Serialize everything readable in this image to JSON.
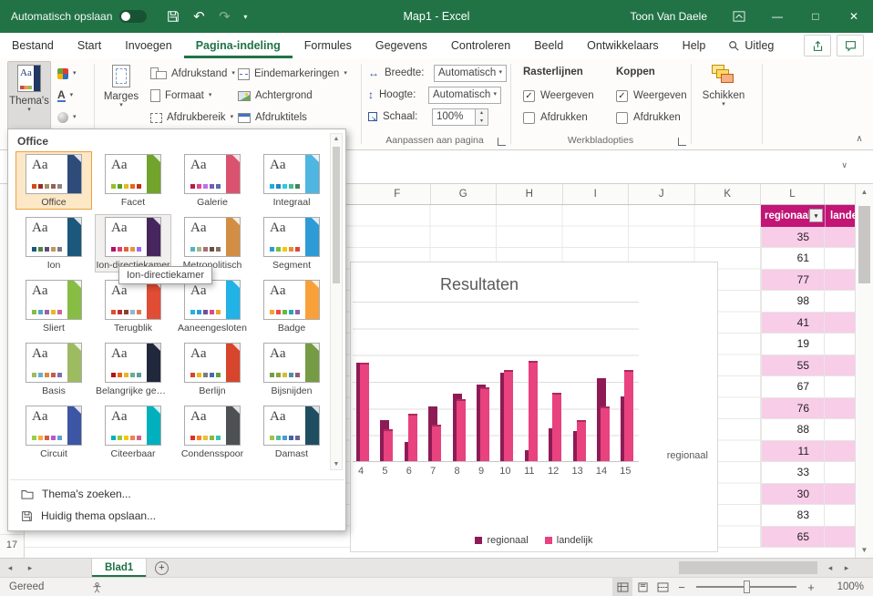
{
  "titlebar": {
    "autosave_label": "Automatisch opslaan",
    "title": "Map1 - Excel",
    "user": "Toon Van Daele"
  },
  "icons": {
    "undo": "↶",
    "redo": "↷",
    "menu_caret": "▾",
    "collapse_ribbon": "∧",
    "expand_formula": "∨",
    "minimize": "—",
    "maximize": "□",
    "close": "✕",
    "scroll_up": "▲",
    "scroll_down": "▼",
    "nav_left": "◂",
    "nav_right": "▸",
    "new_sheet": "+",
    "zoom_out": "−",
    "zoom_in": "+",
    "check": "✓",
    "filter_caret": "▾",
    "spin_up": "▴",
    "spin_down": "▾"
  },
  "tabs": [
    {
      "label": "Bestand",
      "cls": ""
    },
    {
      "label": "Start",
      "cls": ""
    },
    {
      "label": "Invoegen",
      "cls": ""
    },
    {
      "label": "Pagina-indeling",
      "cls": "active"
    },
    {
      "label": "Formules",
      "cls": ""
    },
    {
      "label": "Gegevens",
      "cls": ""
    },
    {
      "label": "Controleren",
      "cls": ""
    },
    {
      "label": "Beeld",
      "cls": ""
    },
    {
      "label": "Ontwikkelaars",
      "cls": ""
    },
    {
      "label": "Help",
      "cls": ""
    }
  ],
  "search_tab": "Uitleg",
  "ribbon": {
    "themes": {
      "label": "Thema's"
    },
    "page_setup": {
      "marges": "Marges",
      "afdrukstand": "Afdrukstand",
      "formaat": "Formaat",
      "afdrukbereik": "Afdrukbereik",
      "eindemarkeringen": "Eindemarkeringen",
      "achtergrond": "Achtergrond",
      "afdruktitels": "Afdruktitels"
    },
    "scale_to_fit": {
      "group_label": "Aanpassen aan pagina",
      "width_label": "Breedte:",
      "width_value": "Automatisch",
      "height_label": "Hoogte:",
      "height_value": "Automatisch",
      "scale_label": "Schaal:",
      "scale_value": "100%"
    },
    "sheet_options": {
      "group_label": "Werkbladopties",
      "gridlines_label": "Rasterlijnen",
      "headings_label": "Koppen",
      "view_label": "Weergeven",
      "print_label": "Afdrukken"
    },
    "arrange": {
      "label": "Schikken"
    }
  },
  "themes_menu": {
    "section_label": "Office",
    "tooltip": "Ion-directiekamer",
    "footer": [
      {
        "label": "Thema's zoeken...",
        "icon": "browse-icon"
      },
      {
        "label": "Huidig thema opslaan...",
        "icon": "save-icon"
      }
    ],
    "tiles": [
      {
        "name": "Office",
        "cls": "selected",
        "band": "#2E4B7A",
        "dots": [
          "#D34817",
          "#9B2D1F",
          "#A28E6A",
          "#956251",
          "#918485"
        ]
      },
      {
        "name": "Facet",
        "cls": "",
        "band": "#72A32D",
        "dots": [
          "#90C226",
          "#54A021",
          "#E6B91E",
          "#E76618",
          "#C42F1A"
        ]
      },
      {
        "name": "Galerie",
        "cls": "",
        "band": "#D9536E",
        "dots": [
          "#B71E42",
          "#DE478E",
          "#BC72F0",
          "#795FAF",
          "#586EA6"
        ]
      },
      {
        "name": "Integraal",
        "cls": "",
        "band": "#4FB6E2",
        "dots": [
          "#1CADE4",
          "#2683C6",
          "#27CED7",
          "#42BA97",
          "#3E8853"
        ]
      },
      {
        "name": "Ion",
        "cls": "",
        "band": "#1B587C",
        "dots": [
          "#1B587C",
          "#4E8542",
          "#604878",
          "#C19859",
          "#797B7E"
        ]
      },
      {
        "name": "Ion-directiekamer",
        "cls": "hovered",
        "band": "#46265C",
        "dots": [
          "#B31166",
          "#E33D6F",
          "#E45F3C",
          "#E9943A",
          "#9B6BF2"
        ]
      },
      {
        "name": "Metropolitisch",
        "cls": "",
        "band": "#D28E45",
        "dots": [
          "#50B4C8",
          "#A8B789",
          "#AB6D76",
          "#684E40",
          "#816F62"
        ]
      },
      {
        "name": "Segment",
        "cls": "",
        "band": "#2E9BD6",
        "dots": [
          "#2E9BD6",
          "#77BF44",
          "#F2C80F",
          "#E98C3A",
          "#D64A3B"
        ]
      },
      {
        "name": "Sliert",
        "cls": "",
        "band": "#87BC45",
        "dots": [
          "#87BC45",
          "#54A6C4",
          "#9B62A7",
          "#E6B91E",
          "#D1609C"
        ]
      },
      {
        "name": "Terugblik",
        "cls": "",
        "band": "#E04C34",
        "dots": [
          "#E04C34",
          "#BA2F2A",
          "#84442F",
          "#94B6D2",
          "#DD8047"
        ]
      },
      {
        "name": "Aaneengesloten",
        "cls": "",
        "band": "#21B2E6",
        "dots": [
          "#21B2E6",
          "#2D9DD8",
          "#6F4F9C",
          "#D94A8C",
          "#F0A22E"
        ]
      },
      {
        "name": "Badge",
        "cls": "",
        "band": "#F8A13A",
        "dots": [
          "#F8A13A",
          "#EF4A45",
          "#5FBB46",
          "#32A0B4",
          "#8C62A8"
        ]
      },
      {
        "name": "Basis",
        "cls": "",
        "band": "#9DBB61",
        "dots": [
          "#9DBB61",
          "#66B0CC",
          "#D98A3A",
          "#C8574E",
          "#7D70A8"
        ]
      },
      {
        "name": "Belangrijke gebeurtenis",
        "cls": "",
        "band": "#22283C",
        "dots": [
          "#B01513",
          "#EA6312",
          "#E6B729",
          "#6AAC90",
          "#5F9C9D"
        ]
      },
      {
        "name": "Berlijn",
        "cls": "",
        "band": "#D6452C",
        "dots": [
          "#D6452C",
          "#E6B91E",
          "#797B7E",
          "#456CB0",
          "#62A339"
        ]
      },
      {
        "name": "Bijsnijden",
        "cls": "",
        "band": "#759B44",
        "dots": [
          "#759B44",
          "#8CA336",
          "#D6BA33",
          "#4C8CAE",
          "#8E5E74"
        ]
      },
      {
        "name": "Circuit",
        "cls": "",
        "band": "#3C55A5",
        "dots": [
          "#9ACD4C",
          "#FAA93A",
          "#D35940",
          "#B258D3",
          "#63A0CC"
        ]
      },
      {
        "name": "Citeerbaar",
        "cls": "",
        "band": "#00B0BD",
        "dots": [
          "#00B0BD",
          "#97C83C",
          "#F2C80F",
          "#E8864C",
          "#D6608B"
        ]
      },
      {
        "name": "Condensspoor",
        "cls": "",
        "band": "#4E5153",
        "dots": [
          "#DF2E28",
          "#FE801A",
          "#E9BF35",
          "#81BB42",
          "#32C7A9"
        ]
      },
      {
        "name": "Damast",
        "cls": "",
        "band": "#1E4E60",
        "dots": [
          "#9EC544",
          "#50BEA3",
          "#4A9CCC",
          "#3E66A4",
          "#6C5F98"
        ]
      }
    ]
  },
  "sheet": {
    "columns": [
      "F",
      "G",
      "H",
      "I",
      "J",
      "K",
      "L"
    ],
    "visible_row_number": "17",
    "table": {
      "header_regionaal": "regionaal",
      "header_landelijk": "landelijk",
      "rows": [
        {
          "v": "35",
          "cls": "pink"
        },
        {
          "v": "61",
          "cls": ""
        },
        {
          "v": "77",
          "cls": "pink"
        },
        {
          "v": "98",
          "cls": ""
        },
        {
          "v": "41",
          "cls": "pink"
        },
        {
          "v": "19",
          "cls": ""
        },
        {
          "v": "55",
          "cls": "pink"
        },
        {
          "v": "67",
          "cls": ""
        },
        {
          "v": "76",
          "cls": "pink"
        },
        {
          "v": "88",
          "cls": ""
        },
        {
          "v": "11",
          "cls": "pink"
        },
        {
          "v": "33",
          "cls": ""
        },
        {
          "v": "30",
          "cls": "pink"
        },
        {
          "v": "83",
          "cls": ""
        },
        {
          "v": "65",
          "cls": "pink"
        }
      ]
    }
  },
  "chart_data": {
    "type": "bar",
    "title": "Resultaten",
    "categories": [
      4,
      5,
      6,
      7,
      8,
      9,
      10,
      11,
      12,
      13,
      14,
      15
    ],
    "series": [
      {
        "name": "regionaal",
        "color": "#8E1B55",
        "values": [
          98,
          41,
          19,
          55,
          67,
          76,
          88,
          11,
          33,
          30,
          83,
          65
        ]
      },
      {
        "name": "landelijk",
        "color": "#E8427F",
        "values": [
          98,
          32,
          47,
          36,
          62,
          74,
          91,
          100,
          68,
          41,
          55,
          91
        ]
      }
    ],
    "right_label": "regionaal",
    "legend": [
      {
        "label": "regionaal",
        "color": "#8E1B55"
      },
      {
        "label": "landelijk",
        "color": "#E8427F"
      }
    ],
    "grid": "horizontal"
  },
  "sheet_tabs": {
    "active": "Blad1"
  },
  "status": {
    "ready": "Gereed",
    "zoom": "100%"
  }
}
